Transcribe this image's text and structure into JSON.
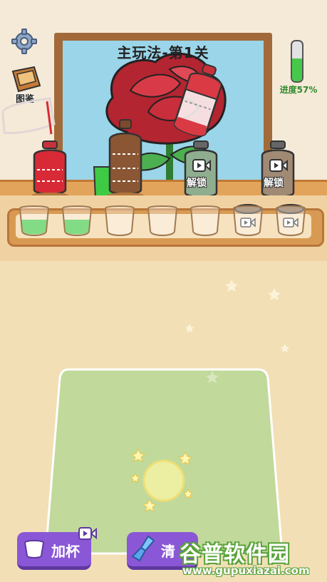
{
  "level_title": "主玩法-第1关",
  "progress": {
    "label": "进度57%",
    "fraction": 0.57
  },
  "catalog_label": "图鉴",
  "unlock_labels": [
    "解锁",
    "解锁"
  ],
  "buttons": {
    "add_cup": "加杯",
    "clear": "清"
  },
  "cups": [
    {
      "state": "green"
    },
    {
      "state": "green"
    },
    {
      "state": "empty"
    },
    {
      "state": "empty"
    },
    {
      "state": "empty"
    },
    {
      "state": "locked"
    },
    {
      "state": "locked"
    }
  ],
  "bottles": [
    {
      "color": "red",
      "state": "filled"
    },
    {
      "color": "brown",
      "state": "filled"
    },
    {
      "color": "green",
      "state": "locked"
    },
    {
      "color": "brown",
      "state": "locked"
    }
  ],
  "colors": {
    "accent_button": "#8a57d6",
    "board": "#c1d99b",
    "green_paint": "#3fca46",
    "red_paint": "#d82a36"
  },
  "watermark": {
    "main": "谷普软件园",
    "url": "www.gupuxiazai.com"
  }
}
